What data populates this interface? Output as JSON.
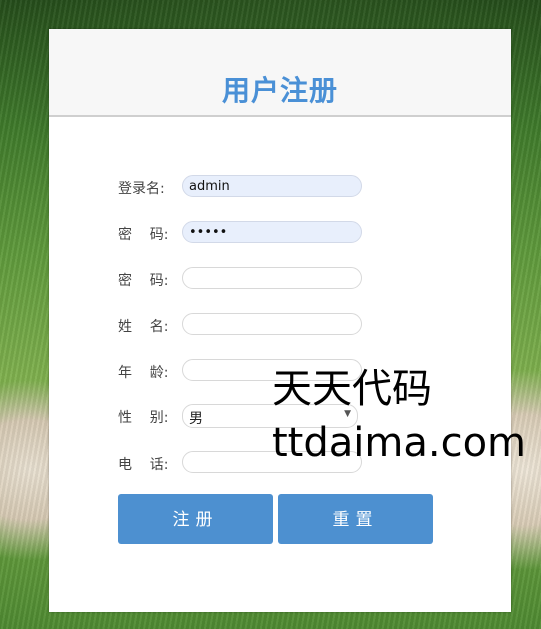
{
  "form": {
    "title": "用户注册",
    "fields": [
      {
        "label": "登录名:",
        "value": "admin",
        "placeholder": ""
      },
      {
        "label": "密    码:",
        "value": "•••••",
        "placeholder": ""
      },
      {
        "label": "密    码:",
        "value": "",
        "placeholder": ""
      },
      {
        "label": "姓    名:",
        "value": "",
        "placeholder": ""
      },
      {
        "label": "年    龄:",
        "value": "",
        "placeholder": ""
      },
      {
        "label": "性    别:",
        "value": "男"
      },
      {
        "label": "电    话:",
        "value": "",
        "placeholder": ""
      }
    ],
    "register_label": "注册",
    "reset_label": "重置"
  },
  "watermark": {
    "line1": "天天代码",
    "line2": "ttdaima.com"
  },
  "colors": {
    "accent": "#4d90d0",
    "title": "#4a90d6",
    "autofill": "#e8effc"
  }
}
